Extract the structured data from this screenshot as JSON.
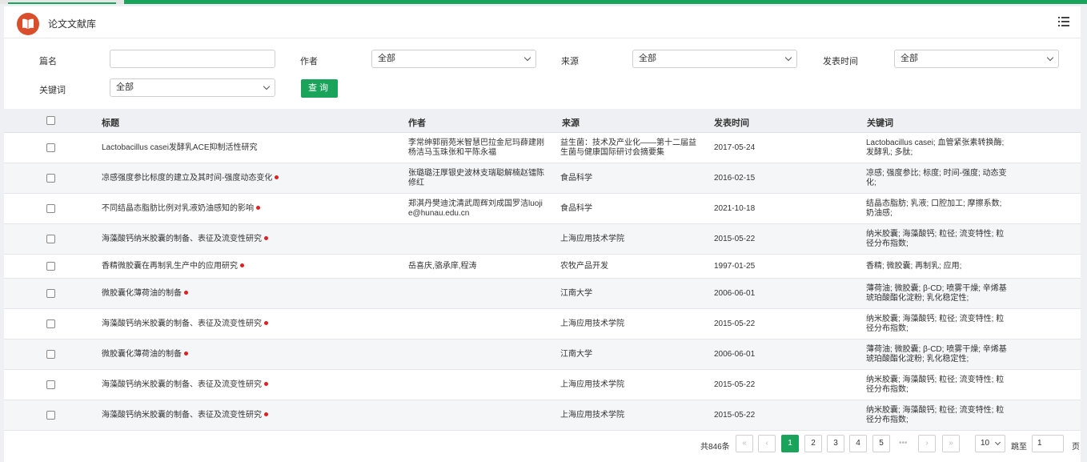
{
  "app": {
    "title": "论文文献库"
  },
  "filters": {
    "title_label": "篇名",
    "title_value": "",
    "author_label": "作者",
    "author_value": "全部",
    "source_label": "来源",
    "source_value": "全部",
    "date_label": "发表时间",
    "date_value": "全部",
    "keyword_label": "关键词",
    "keyword_value": "全部",
    "query_button": "查询"
  },
  "table": {
    "headers": {
      "title": "标题",
      "author": "作者",
      "source": "来源",
      "date": "发表时间",
      "keywords": "关键词"
    },
    "rows": [
      {
        "title": "Lactobacillus casei发酵乳ACE抑制活性研究",
        "dot": false,
        "author": "李常绅郭丽苑米智慧巴拉金尼玛薛建刚杨洁马玉珠张和平陈永福",
        "source": "益生菌：技术及产业化——第十二届益生菌与健康国际研讨会摘要集",
        "date": "2017-05-24",
        "keywords": "Lactobacillus casei; 血管紧张素转换酶; 发酵乳; 多肽;"
      },
      {
        "title": "凉感强度参比标度的建立及其时间-强度动态变化",
        "dot": true,
        "author": "张璐璐汪厚银史波林支瑞聪解楠赵镭陈修红",
        "source": "食品科学",
        "date": "2016-02-15",
        "keywords": "凉感; 强度参比; 标度; 时间-强度; 动态变化;"
      },
      {
        "title": "不同结晶态脂肪比例对乳液奶油感知的影响",
        "dot": true,
        "author": "郑淇丹樊迪沈清武周辉刘成国罗洁luojie@hunau.edu.cn",
        "source": "食品科学",
        "date": "2021-10-18",
        "keywords": "结晶态脂肪; 乳液; 口腔加工; 摩擦系数; 奶油感;"
      },
      {
        "title": "海藻酸钙纳米胶囊的制备、表征及流变性研究",
        "dot": true,
        "author": "",
        "source": "上海应用技术学院",
        "date": "2015-05-22",
        "keywords": "纳米胶囊; 海藻酸钙; 粒径; 流变特性; 粒径分布指数;"
      },
      {
        "title": "香精微胶囊在再制乳生产中的应用研究",
        "dot": true,
        "author": "岳喜庆,骆承庠,程涛",
        "source": "农牧产品开发",
        "date": "1997-01-25",
        "keywords": "香精; 微胶囊; 再制乳; 应用;"
      },
      {
        "title": "微胶囊化薄荷油的制备",
        "dot": true,
        "author": "",
        "source": "江南大学",
        "date": "2006-06-01",
        "keywords": "薄荷油; 微胶囊; β-CD; 喷雾干燥; 辛烯基琥珀酸酯化淀粉; 乳化稳定性;"
      },
      {
        "title": "海藻酸钙纳米胶囊的制备、表征及流变性研究",
        "dot": true,
        "author": "",
        "source": "上海应用技术学院",
        "date": "2015-05-22",
        "keywords": "纳米胶囊; 海藻酸钙; 粒径; 流变特性; 粒径分布指数;"
      },
      {
        "title": "微胶囊化薄荷油的制备",
        "dot": true,
        "author": "",
        "source": "江南大学",
        "date": "2006-06-01",
        "keywords": "薄荷油; 微胶囊; β-CD; 喷雾干燥; 辛烯基琥珀酸酯化淀粉; 乳化稳定性;"
      },
      {
        "title": "海藻酸钙纳米胶囊的制备、表征及流变性研究",
        "dot": true,
        "author": "",
        "source": "上海应用技术学院",
        "date": "2015-05-22",
        "keywords": "纳米胶囊; 海藻酸钙; 粒径; 流变特性; 粒径分布指数;"
      },
      {
        "title": "海藻酸钙纳米胶囊的制备、表征及流变性研究",
        "dot": true,
        "author": "",
        "source": "上海应用技术学院",
        "date": "2015-05-22",
        "keywords": "纳米胶囊; 海藻酸钙; 粒径; 流变特性; 粒径分布指数;"
      }
    ]
  },
  "pagination": {
    "total": "共846条",
    "pages": [
      "1",
      "2",
      "3",
      "4",
      "5"
    ],
    "active_page": "1",
    "ellipsis": "•••",
    "page_size": "10",
    "jump_label": "跳至",
    "jump_value": "1",
    "page_suffix": "页"
  },
  "colors": {
    "accent": "#1aa35a",
    "logo": "#d94f2b",
    "marker": "#e02020"
  }
}
